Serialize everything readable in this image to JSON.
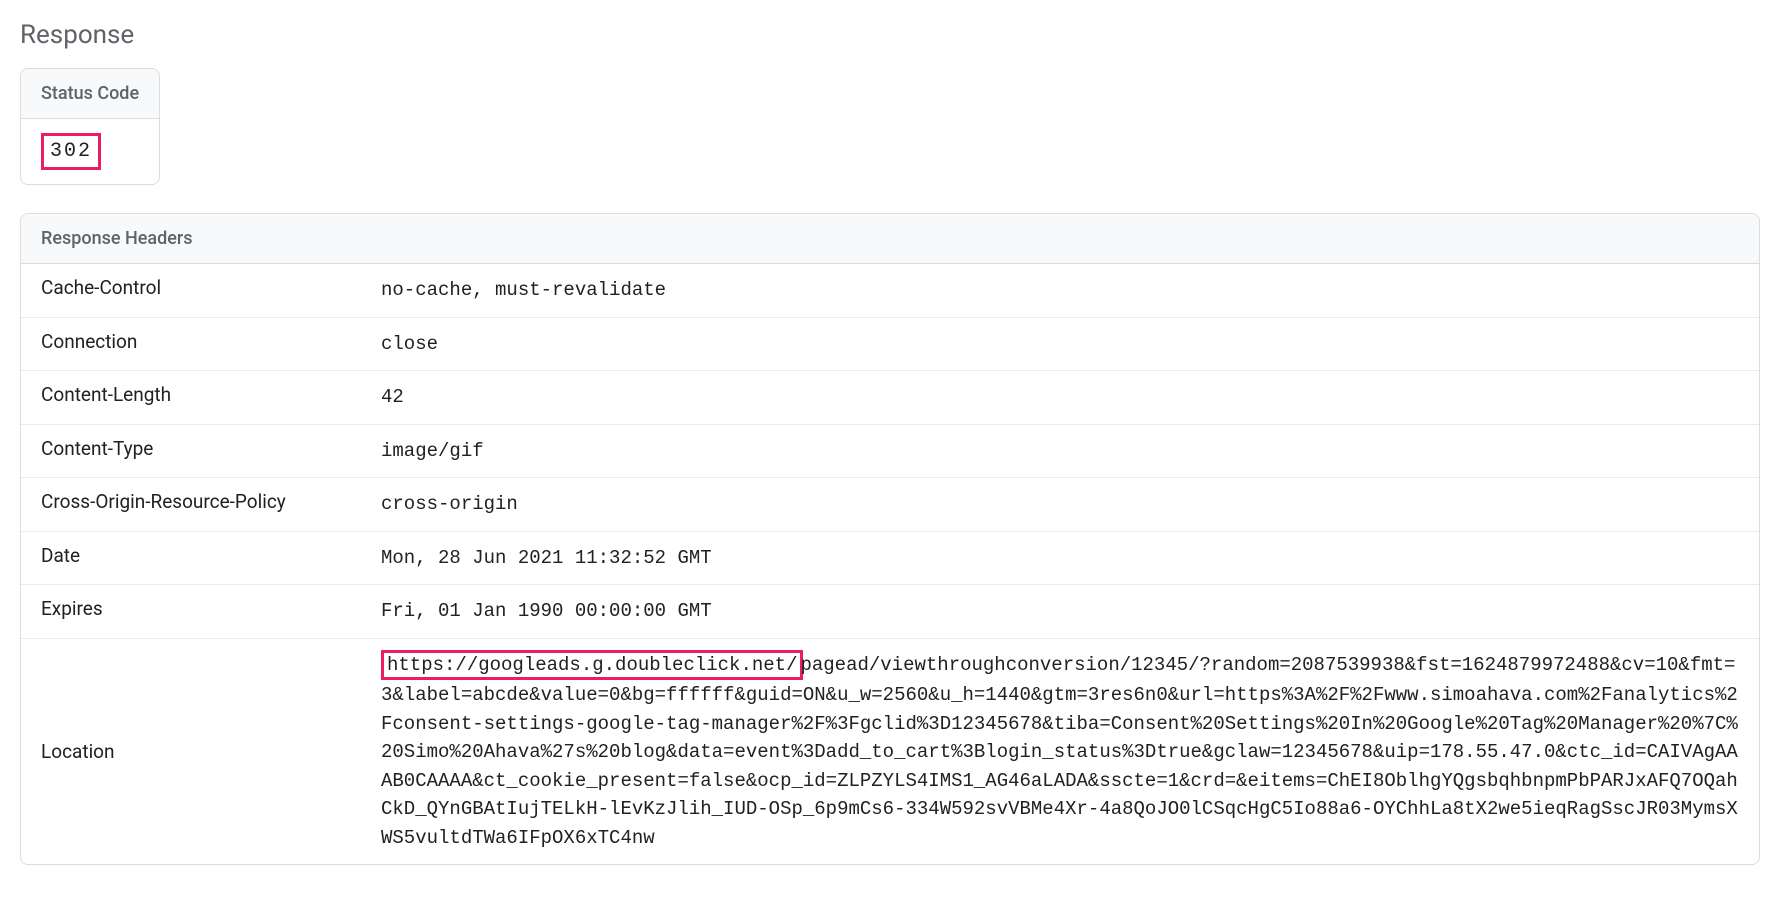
{
  "section": {
    "title": "Response"
  },
  "status": {
    "label": "Status Code",
    "value": "302"
  },
  "headers": {
    "title": "Response Headers",
    "rows": [
      {
        "name": "Cache-Control",
        "value": "no-cache, must-revalidate"
      },
      {
        "name": "Connection",
        "value": "close"
      },
      {
        "name": "Content-Length",
        "value": "42"
      },
      {
        "name": "Content-Type",
        "value": "image/gif"
      },
      {
        "name": "Cross-Origin-Resource-Policy",
        "value": "cross-origin"
      },
      {
        "name": "Date",
        "value": "Mon, 28 Jun 2021 11:32:52 GMT"
      },
      {
        "name": "Expires",
        "value": "Fri, 01 Jan 1990 00:00:00 GMT"
      }
    ],
    "location": {
      "name": "Location",
      "highlight_prefix": "https://googleads.g.doubleclick.net/",
      "rest": "pagead/viewthroughconversion/12345/?random=2087539938&fst=1624879972488&cv=10&fmt=3&label=abcde&value=0&bg=ffffff&guid=ON&u_w=2560&u_h=1440&gtm=3res6n0&url=https%3A%2F%2Fwww.simoahava.com%2Fanalytics%2Fconsent-settings-google-tag-manager%2F%3Fgclid%3D12345678&tiba=Consent%20Settings%20In%20Google%20Tag%20Manager%20%7C%20Simo%20Ahava%27s%20blog&data=event%3Dadd_to_cart%3Blogin_status%3Dtrue&gclaw=12345678&uip=178.55.47.0&ctc_id=CAIVAgAAAB0CAAAA&ct_cookie_present=false&ocp_id=ZLPZYLS4IMS1_AG46aLADA&sscte=1&crd=&eitems=ChEI8OblhgYQgsbqhbnpmPbPARJxAFQ7OQahCkD_QYnGBAtIujTELkH-lEvKzJlih_IUD-OSp_6p9mCs6-334W592svVBMe4Xr-4a8QoJO0lCSqcHgC5Io88a6-OYChhLa8tX2we5ieqRagSscJR03MymsXWS5vultdTWa6IFpOX6xTC4nw"
    }
  },
  "annotations": {
    "highlight_color": "#e91e63"
  }
}
